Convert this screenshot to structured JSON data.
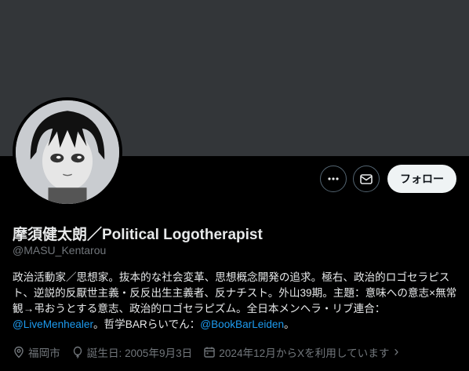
{
  "profile": {
    "display_name": "摩須健太朗／Political Logotherapist",
    "handle": "@MASU_Kentarou"
  },
  "actions": {
    "more_icon": "more-icon",
    "message_icon": "envelope-icon",
    "follow_label": "フォロー"
  },
  "bio": {
    "text_1": "政治活動家／思想家。抜本的な社会変革、思想概念開発の追求。極右、政治的ロゴセラピスト、逆説的反厭世主義・反反出生主義者、反ナチスト。外山39期。主題：意味への意志×無常観→弔おうとする意志、政治的ロゴセラピズム。全日本メンヘラ・リブ連合：",
    "link_1": "@LiveMenhealer",
    "text_2": "。哲学BARらいでん：",
    "link_2": "@BookBarLeiden",
    "text_3": "。"
  },
  "meta": {
    "location": "福岡市",
    "birthday": "誕生日: 2005年9月3日",
    "joined": "2024年12月からXを利用しています",
    "chevron": "›"
  },
  "colors": {
    "background": "#000000",
    "banner": "#333639",
    "link": "#1d9bf0",
    "muted": "#71767b",
    "text": "#e7e9ea"
  }
}
